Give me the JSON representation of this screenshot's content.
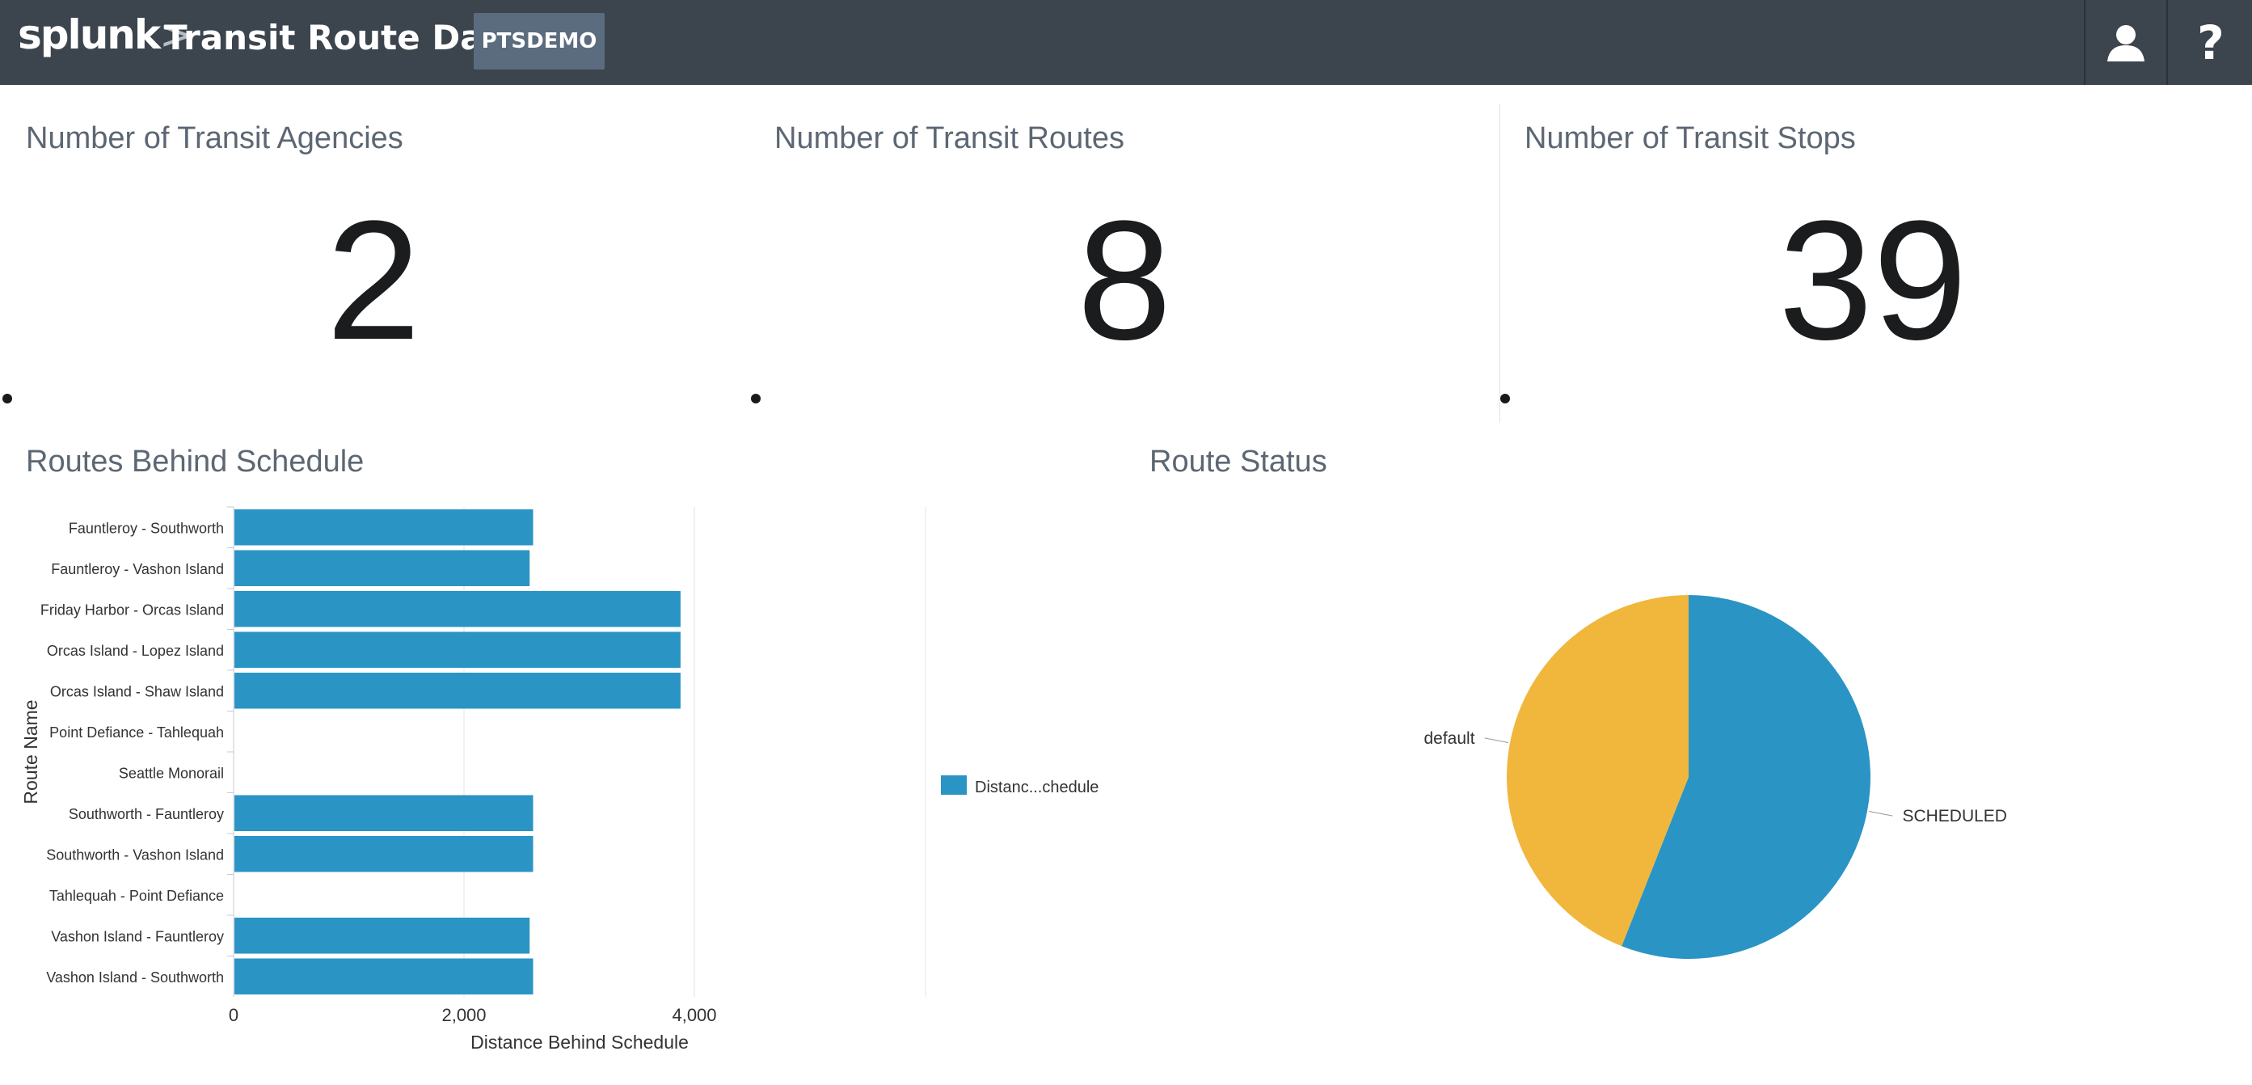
{
  "header": {
    "logo_text": "splunk",
    "logo_chevron": ">",
    "app_title": "Transit Route Data",
    "app_badge": "PTSDEMO",
    "user_icon": "user-icon",
    "help_icon": "help-icon",
    "help_label": "?"
  },
  "panels": {
    "agencies": {
      "title": "Number of Transit Agencies",
      "value": "2"
    },
    "routes": {
      "title": "Number of Transit Routes",
      "value": "8"
    },
    "stops": {
      "title": "Number of Transit Stops",
      "value": "39"
    },
    "behind": {
      "title": "Routes Behind Schedule"
    },
    "status": {
      "title": "Route Status"
    }
  },
  "colors": {
    "header_bg": "#3c444d",
    "bar": "#2a94c5",
    "pie_scheduled": "#2a94c5",
    "pie_default": "#f0b73c"
  },
  "chart_data": [
    {
      "type": "bar",
      "orientation": "horizontal",
      "categories": [
        "Fauntleroy - Southworth",
        "Fauntleroy - Vashon Island",
        "Friday Harbor - Orcas Island",
        "Orcas Island - Lopez Island",
        "Orcas Island - Shaw Island",
        "Point Defiance - Tahlequah",
        "Seattle Monorail",
        "Southworth - Fauntleroy",
        "Southworth - Vashon Island",
        "Tahlequah - Point Defiance",
        "Vashon Island - Fauntleroy",
        "Vashon Island - Southworth"
      ],
      "series": [
        {
          "name": "Distanc...chedule",
          "values": [
            2600,
            2570,
            3880,
            3880,
            3880,
            0,
            0,
            2600,
            2600,
            0,
            2570,
            2600
          ]
        }
      ],
      "xlabel": "Distance Behind Schedule",
      "ylabel": "Route Name",
      "xlim": [
        0,
        4000
      ],
      "xticks": [
        "0",
        "2,000",
        "4,000"
      ],
      "grid": true,
      "legend": "right"
    },
    {
      "type": "pie",
      "labels": [
        "SCHEDULED",
        "default"
      ],
      "values": [
        56,
        44
      ]
    }
  ]
}
